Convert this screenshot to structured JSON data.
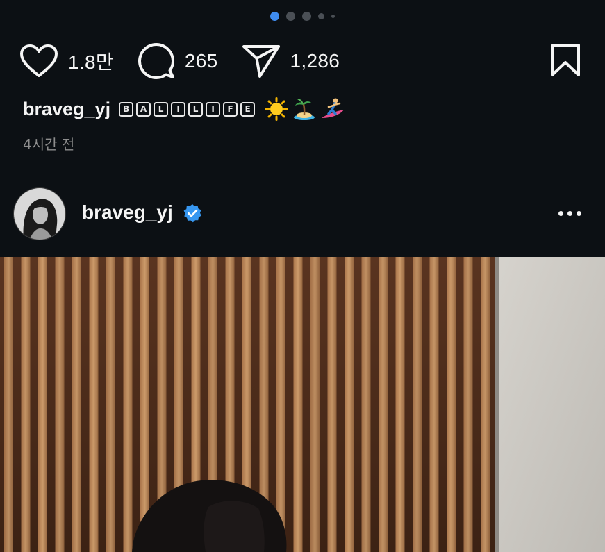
{
  "carousel": {
    "dot_count": 5,
    "active_index": 0
  },
  "actions": {
    "likes": "1.8만",
    "comments": "265",
    "shares": "1,286"
  },
  "caption": {
    "username": "braveg_yj",
    "boxed_letters": [
      "B",
      "A",
      "L",
      "I",
      "L",
      "I",
      "F",
      "E"
    ],
    "emojis": [
      "sun-emoji",
      "island-emoji",
      "surfer-emoji"
    ],
    "time_ago": "4시간 전"
  },
  "post": {
    "username": "braveg_yj",
    "verified": true,
    "avatar": "profile-photo-bw"
  },
  "colors": {
    "background": "#0c1014",
    "text": "#f5f5f5",
    "muted": "#8e8e8e",
    "active_dot": "#3f8cf0",
    "verified_badge": "#3797f0"
  }
}
